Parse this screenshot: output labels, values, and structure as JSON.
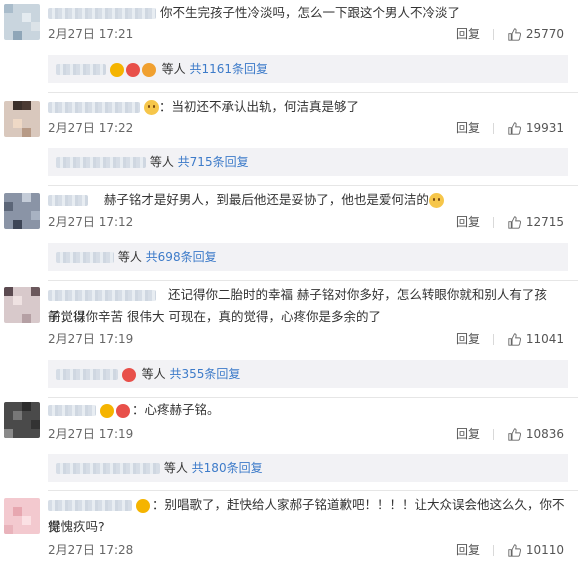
{
  "comments": [
    {
      "text": "你不生完孩子性冷淡吗，怎么一下跟这个男人不冷淡了",
      "time": "2月27日 17:21",
      "reply_label": "回复",
      "likes": "25770",
      "replies_suffix": "等人",
      "replies_link": "共1161条回复"
    },
    {
      "text": "：当初还不承认出轨，何洁真是够了",
      "time": "2月27日 17:22",
      "reply_label": "回复",
      "likes": "19931",
      "replies_suffix": "等人",
      "replies_link": "共715条回复"
    },
    {
      "text": "赫子铭才是好男人，到最后他还是妥协了，他也是爱何洁的",
      "time": "2月27日 17:12",
      "reply_label": "回复",
      "likes": "12715",
      "replies_suffix": "等人",
      "replies_link": "共698条回复"
    },
    {
      "text": "还记得你二胎时的幸福 赫子铭对你多好，怎么转眼你就和别人有了孩子，以",
      "text2": "前觉得你辛苦 很伟大 可现在，真的觉得，心疼你是多余的了",
      "time": "2月27日 17:19",
      "reply_label": "回复",
      "likes": "11041",
      "replies_suffix": "等人",
      "replies_link": "共355条回复"
    },
    {
      "text": "：心疼赫子铭。",
      "time": "2月27日 17:19",
      "reply_label": "回复",
      "likes": "10836",
      "replies_suffix": "等人",
      "replies_link": "共180条回复"
    },
    {
      "text": "：别唱歌了，赶快给人家郝子铭道歉吧！！！！让大众误会他这么久，你不觉",
      "text2": "得愧疚吗?",
      "time": "2月27日 17:28",
      "reply_label": "回复",
      "likes": "10110"
    }
  ],
  "icons": {
    "like": "thumbs-up-icon",
    "emoji": "sweat-emoji-icon",
    "badge": "user-badge-icon"
  },
  "colors": {
    "link": "#3d7bc9",
    "subbox_bg": "#f2f2f5",
    "meta_text": "#666666"
  }
}
